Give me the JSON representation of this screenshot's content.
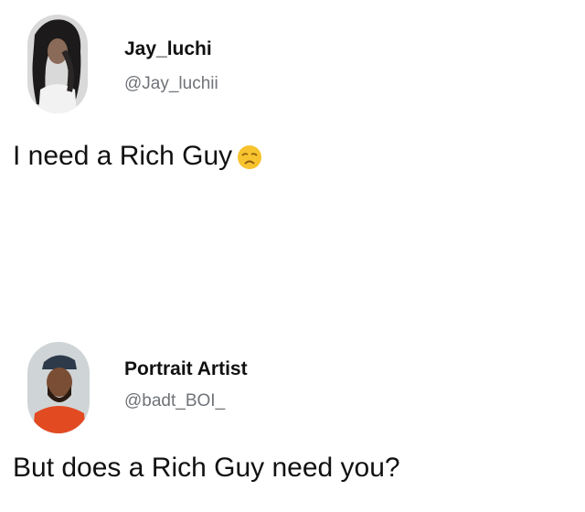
{
  "tweets": [
    {
      "display_name": "Jay_luchi",
      "handle": "@Jay_luchii",
      "text": "I need a Rich Guy",
      "emoji": "weary-face-emoji"
    },
    {
      "display_name": "Portrait Artist",
      "handle": "@badt_BOI_",
      "text": "But does a Rich Guy need you?"
    }
  ],
  "colors": {
    "text": "#111111",
    "handle": "#6f7378",
    "emoji": "#f7c32e"
  }
}
